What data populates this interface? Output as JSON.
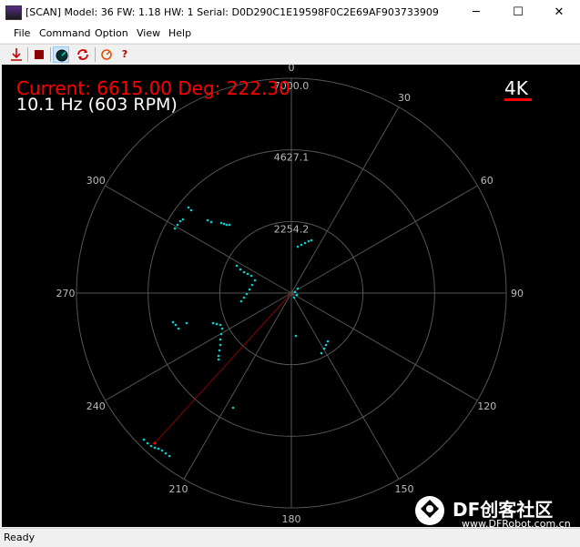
{
  "window": {
    "title": "[SCAN] Model: 36 FW: 1.18 HW: 1 Serial: D0D290C1E19598F0C2E69AF903733909",
    "minimize_glyph": "─",
    "maximize_glyph": "☐",
    "close_glyph": "✕"
  },
  "menu": [
    "File",
    "Command",
    "Option",
    "View",
    "Help"
  ],
  "toolbar": {
    "icons": [
      "start-scan-icon",
      "stop-icon",
      "radar-view-icon",
      "refresh-icon",
      "reset-icon",
      "help-icon"
    ],
    "help_glyph": "?"
  },
  "radar": {
    "current_text": "Current: 6615.00 Deg: 222.30",
    "rate_text": "10.1 Hz (603 RPM)",
    "mode_label": "4K",
    "range_labels": [
      "7000.0",
      "4627.1",
      "2254.2"
    ],
    "angle_labels": [
      "0",
      "30",
      "60",
      "90",
      "120",
      "150",
      "180",
      "210",
      "240",
      "270",
      "300"
    ],
    "current_angle_deg": 222.3,
    "current_range": 6615.0,
    "max_range": 7000.0,
    "colors": {
      "background": "#000000",
      "grid": "#555555",
      "points": "#00d0d0",
      "current": "#ff0000",
      "text": "#ffffff",
      "beam": "#8b0000"
    }
  },
  "watermark": {
    "brand": "DF创客社区",
    "url": "www.DFRobot.com.cn"
  },
  "status": {
    "text": "Ready"
  }
}
